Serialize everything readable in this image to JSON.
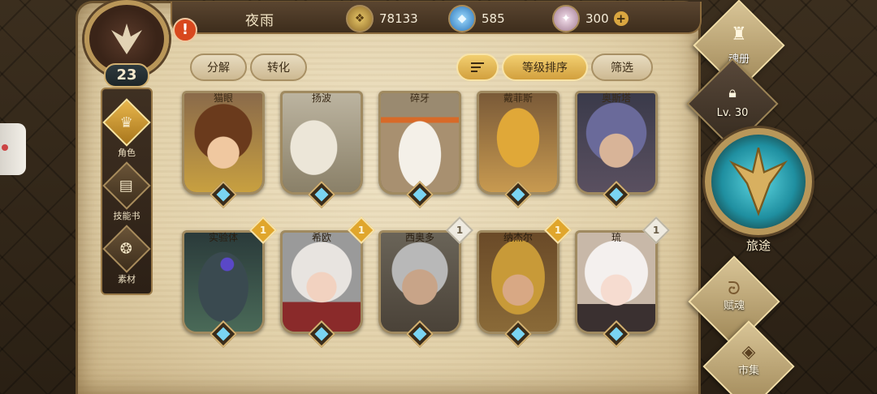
{
  "player": {
    "name": "夜雨",
    "level": "23",
    "alert_label": "!"
  },
  "resources": [
    {
      "icon": "gold-coin-icon",
      "value": "78133"
    },
    {
      "icon": "blue-crystal-icon",
      "value": "585"
    },
    {
      "icon": "pink-crystal-icon",
      "value": "300",
      "add_label": "+"
    }
  ],
  "left_nav": [
    {
      "icon": "character-icon",
      "label": "角色",
      "active": true
    },
    {
      "icon": "skill-book-icon",
      "label": "技能书",
      "active": false
    },
    {
      "icon": "material-icon",
      "label": "素材",
      "active": false
    }
  ],
  "toolbar": {
    "decompose": "分解",
    "convert": "转化",
    "sort_by_level": "等级排序",
    "filter": "筛选"
  },
  "heroes_row1": [
    {
      "name": "猫眼",
      "portrait": "brown-hair-girl"
    },
    {
      "name": "扬波",
      "portrait": "polar-bear-warrior"
    },
    {
      "name": "碎牙",
      "portrait": "polar-bear-headband"
    },
    {
      "name": "戴菲斯",
      "portrait": "golden-lizard"
    },
    {
      "name": "奥斯塔",
      "portrait": "purple-hair-man"
    }
  ],
  "heroes_row2": [
    {
      "name": "实验体",
      "portrait": "golem",
      "rank": "1",
      "rank_color": "gold"
    },
    {
      "name": "希欧",
      "portrait": "white-hair-helmet-girl",
      "rank": "1",
      "rank_color": "gold"
    },
    {
      "name": "西奥多",
      "portrait": "grey-hair-old-man",
      "rank": "1",
      "rank_color": "silver"
    },
    {
      "name": "纳杰尔",
      "portrait": "hooded-archer",
      "rank": "1",
      "rank_color": "gold"
    },
    {
      "name": "琉",
      "portrait": "white-hair-girl",
      "rank": "1",
      "rank_color": "silver"
    }
  ],
  "right_menu": {
    "soul_book": "魂册",
    "locked_level": "Lv. 30",
    "journey": "旅途",
    "soul_gift": "赋魂",
    "market": "市集"
  },
  "colors": {
    "parchment": "#e8d8b4",
    "frame_dark": "#3d2d1c",
    "gold_accent": "#e0a62c",
    "gem_blue": "#7ad4f2",
    "journey_teal": "#1f8fa0"
  }
}
